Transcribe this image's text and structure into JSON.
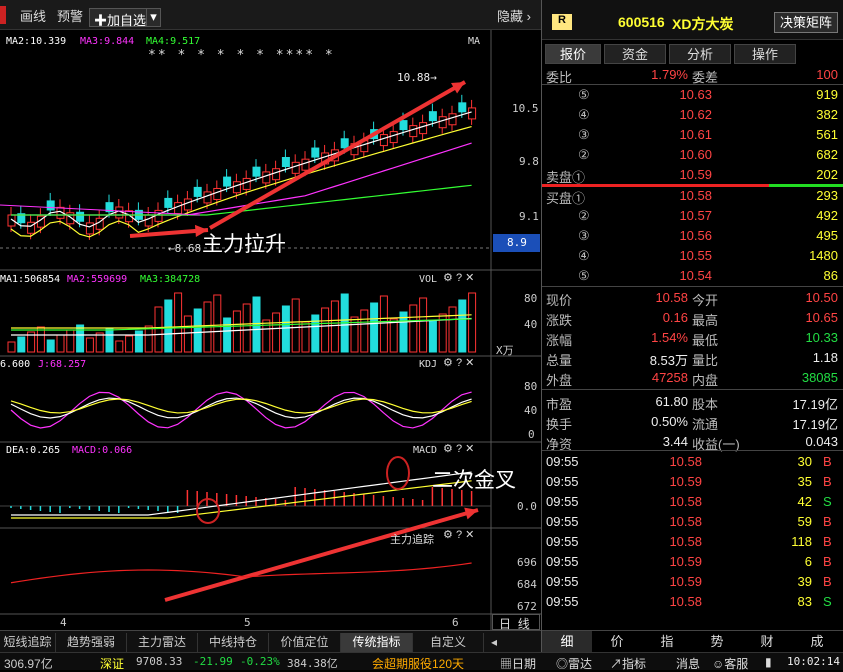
{
  "toolbar": {
    "draw": "画线",
    "alert": "预警",
    "add_fav": "加自选",
    "hide": "隐藏"
  },
  "ma_line": {
    "ma2": "MA2:10.339",
    "ma3": "MA3:9.844",
    "ma4": "MA4:9.517",
    "ma": "MA"
  },
  "stars": "**   *  *  *  *   *  ****  *",
  "price_axis": [
    "10.5",
    "9.8",
    "9.1"
  ],
  "current_price_tag": "8.9",
  "high_label": "10.88",
  "low_label": "8.68",
  "annotations": {
    "main": "主力拉升",
    "cross": "二次金叉"
  },
  "vol": {
    "ma1": "MA1:506854",
    "ma2": "MA2:559699",
    "ma3": "MA3:384728",
    "name": "VOL",
    "axis": [
      "80",
      "40"
    ],
    "unit": "X万"
  },
  "kdj": {
    "d": "6.600",
    "j": "J:68.257",
    "name": "KDJ",
    "axis": [
      "80",
      "40",
      "0"
    ]
  },
  "macd": {
    "dea": "DEA:0.265",
    "macd": "MACD:0.066",
    "name": "MACD",
    "axis": [
      "0.0"
    ]
  },
  "tracker": {
    "name": "主力追踪",
    "axis": [
      "696",
      "684",
      "672"
    ]
  },
  "date_axis": [
    "4",
    "5",
    "6"
  ],
  "toggle": {
    "day": "日",
    "line": "线"
  },
  "bottom_tabs": [
    "短线追踪",
    "趋势强弱",
    "主力雷达",
    "中线持仓",
    "价值定位",
    "传统指标",
    "自定义"
  ],
  "status": {
    "index_val": "306.97亿",
    "sz_name": "深证",
    "sz_val": "9708.33",
    "sz_chg": "-21.99",
    "sz_pct": "-0.23%",
    "sz_amt": "384.38亿",
    "promo": "会超期服役120天",
    "ribao": "日期",
    "radar": "雷达",
    "indicator": "指标",
    "news": "消息",
    "service": "客服",
    "time": "10:02:14"
  },
  "quote": {
    "badge": "R",
    "code": "600516",
    "name": "XD方大炭",
    "matrix_btn": "决策矩阵",
    "tabs": [
      "报价",
      "资金",
      "分析",
      "操作"
    ],
    "weibi_label": "委比",
    "weibi": "1.79%",
    "weicha_label": "委差",
    "weicha": "100",
    "sell": [
      {
        "lvl": "⑤",
        "p": "10.63",
        "v": "919"
      },
      {
        "lvl": "④",
        "p": "10.62",
        "v": "382"
      },
      {
        "lvl": "③",
        "p": "10.61",
        "v": "561"
      },
      {
        "lvl": "②",
        "p": "10.60",
        "v": "682"
      },
      {
        "lvl": "卖盘①",
        "p": "10.59",
        "v": "202"
      }
    ],
    "buy": [
      {
        "lvl": "买盘①",
        "p": "10.58",
        "v": "293"
      },
      {
        "lvl": "②",
        "p": "10.57",
        "v": "492"
      },
      {
        "lvl": "③",
        "p": "10.56",
        "v": "495"
      },
      {
        "lvl": "④",
        "p": "10.55",
        "v": "1480"
      },
      {
        "lvl": "⑤",
        "p": "10.54",
        "v": "86"
      }
    ],
    "stats": [
      {
        "l1": "现价",
        "v1": "10.58",
        "c1": "red",
        "l2": "今开",
        "v2": "10.50",
        "c2": "red"
      },
      {
        "l1": "涨跌",
        "v1": "0.16",
        "c1": "red",
        "l2": "最高",
        "v2": "10.65",
        "c2": "red"
      },
      {
        "l1": "涨幅",
        "v1": "1.54%",
        "c1": "red",
        "l2": "最低",
        "v2": "10.33",
        "c2": "green"
      },
      {
        "l1": "总量",
        "v1": "8.53万",
        "c1": "white",
        "l2": "量比",
        "v2": "1.18",
        "c2": "white"
      },
      {
        "l1": "外盘",
        "v1": "47258",
        "c1": "red",
        "l2": "内盘",
        "v2": "38085",
        "c2": "green"
      },
      {
        "l1": "市盈",
        "v1": "61.80",
        "c1": "white",
        "l2": "股本",
        "v2": "17.19亿",
        "c2": "white"
      },
      {
        "l1": "换手",
        "v1": "0.50%",
        "c1": "white",
        "l2": "流通",
        "v2": "17.19亿",
        "c2": "white"
      },
      {
        "l1": "净资",
        "v1": "3.44",
        "c1": "white",
        "l2": "收益(一)",
        "v2": "0.043",
        "c2": "white"
      }
    ],
    "ticks": [
      {
        "t": "09:55",
        "p": "10.58",
        "v": "30",
        "s": "B"
      },
      {
        "t": "09:55",
        "p": "10.59",
        "v": "35",
        "s": "B"
      },
      {
        "t": "09:55",
        "p": "10.58",
        "v": "42",
        "s": "S"
      },
      {
        "t": "09:55",
        "p": "10.58",
        "v": "59",
        "s": "B"
      },
      {
        "t": "09:55",
        "p": "10.58",
        "v": "118",
        "s": "B"
      },
      {
        "t": "09:55",
        "p": "10.59",
        "v": "6",
        "s": "B"
      },
      {
        "t": "09:55",
        "p": "10.59",
        "v": "39",
        "s": "B"
      },
      {
        "t": "09:55",
        "p": "10.58",
        "v": "83",
        "s": "S"
      }
    ],
    "bottom_tabs": [
      "细",
      "价",
      "指",
      "势",
      "财",
      "成"
    ]
  }
}
